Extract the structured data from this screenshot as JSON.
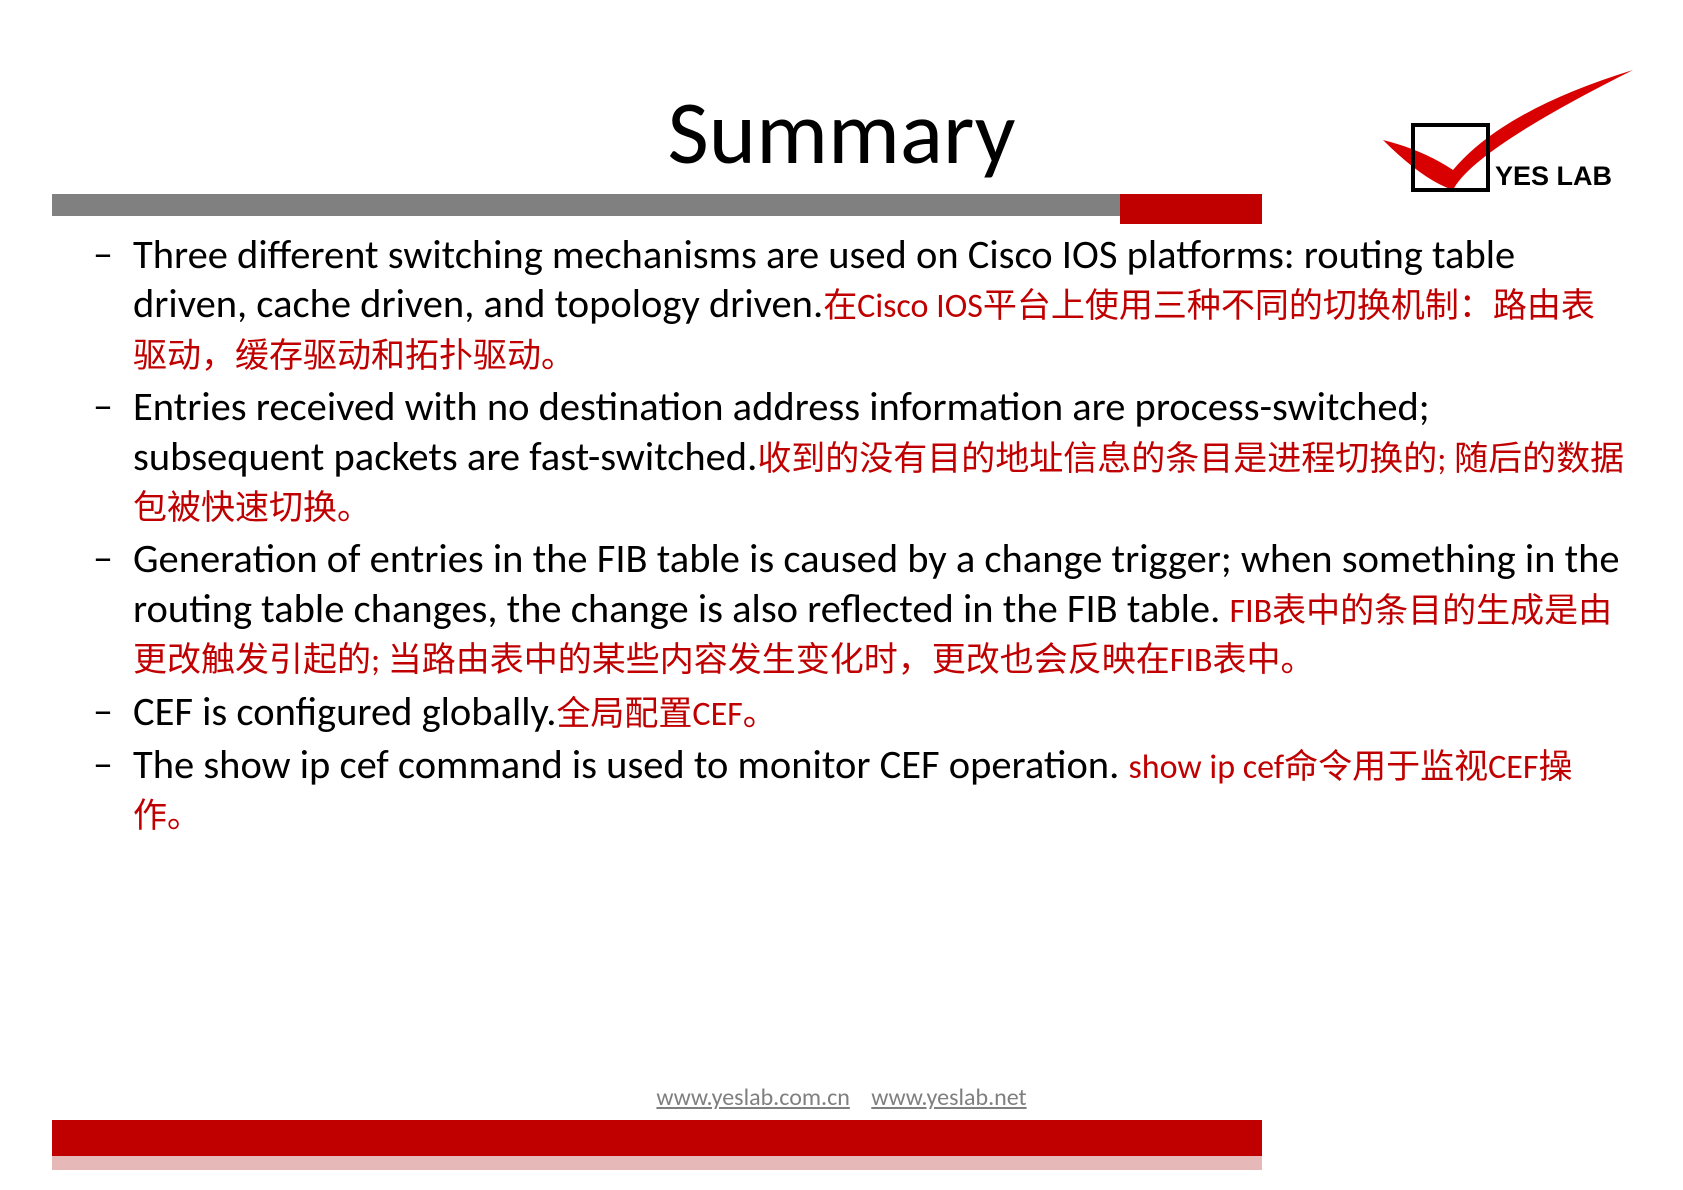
{
  "title": "Summary",
  "logo": {
    "text": "YES LAB"
  },
  "bullets": [
    {
      "eng": "Three different switching mechanisms are used on  Cisco IOS platforms: routing table driven, cache driven,  and topology driven.",
      "zh": "在Cisco IOS平台上使用三种不同的切换机制：路由表驱动，缓存驱动和拓扑驱动。"
    },
    {
      "eng": "Entries received with no destination address  information are process-switched; subsequent packets  are fast-switched.",
      "zh": "收到的没有目的地址信息的条目是进程切换的; 随后的数据包被快速切换。"
    },
    {
      "eng": "Generation of entries in the FIB table is caused by a  change trigger; when something in the routing table  changes, the change is also reflected in the FIB table. ",
      "zh": "FIB表中的条目的生成是由更改触发引起的; 当路由表中的某些内容发生变化时，更改也会反映在FIB表中。"
    },
    {
      "eng": "CEF is configured globally.",
      "zh": "全局配置CEF。"
    },
    {
      "eng": "The show ip cef command is used to monitor CEF operation. ",
      "zh": "show ip cef命令用于监视CEF操作。"
    }
  ],
  "footer": {
    "link1": "www.yeslab.com.cn",
    "link2": "www.yeslab.net"
  }
}
